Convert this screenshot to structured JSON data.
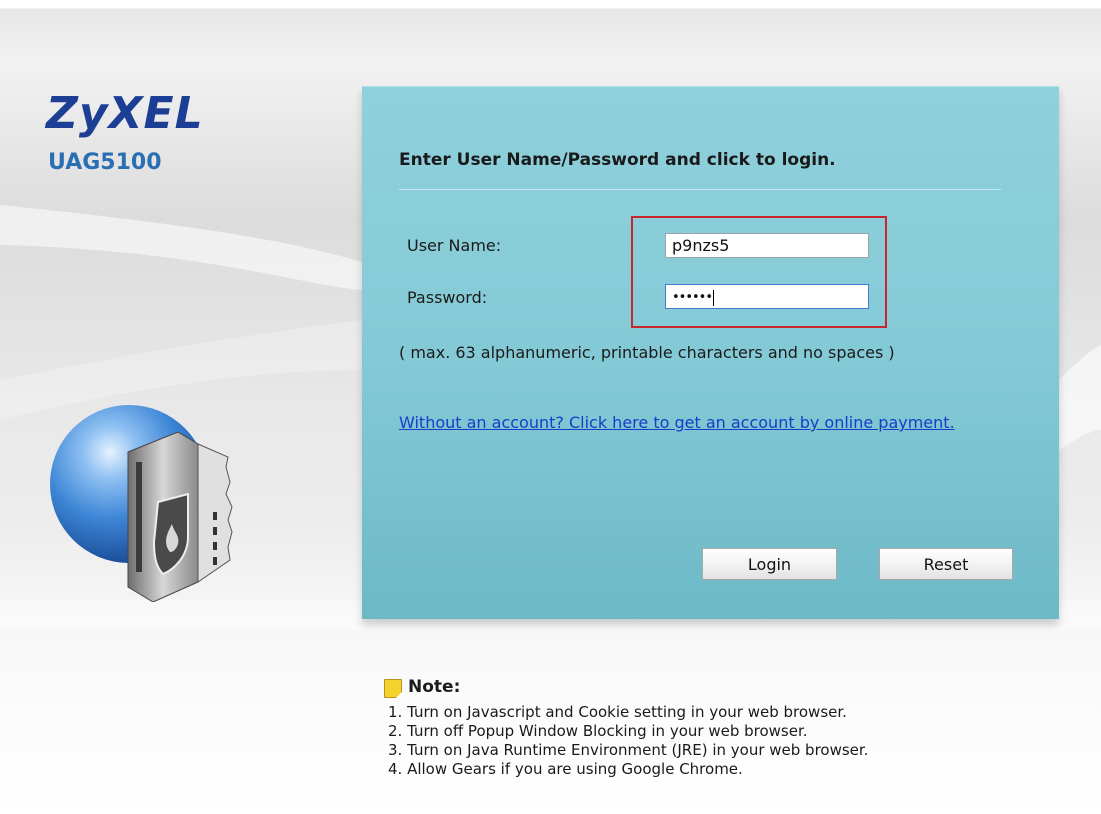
{
  "brand": {
    "logo_text": "ZyXEL",
    "model": "UAG5100"
  },
  "login": {
    "heading": "Enter User Name/Password and click to login.",
    "username_label": "User Name:",
    "username_value": "p9nzs5",
    "password_label": "Password:",
    "password_masked": "••••••",
    "hint": "( max. 63 alphanumeric, printable characters and no spaces )",
    "account_link": "Without an account? Click here to get an account by online payment.",
    "login_button": "Login",
    "reset_button": "Reset"
  },
  "note": {
    "title": "Note:",
    "items": [
      "1. Turn on Javascript and Cookie setting in your web browser.",
      "2. Turn off Popup Window Blocking in your web browser.",
      "3. Turn on Java Runtime Environment (JRE) in your web browser.",
      "4. Allow Gears if you are using Google Chrome."
    ]
  },
  "colors": {
    "panel": "#84cad6",
    "brand_blue": "#1c3f95",
    "highlight_red": "#c8262c",
    "link_blue": "#1a3cc8"
  },
  "icons": [
    "globe-firewall-icon",
    "note-icon"
  ]
}
